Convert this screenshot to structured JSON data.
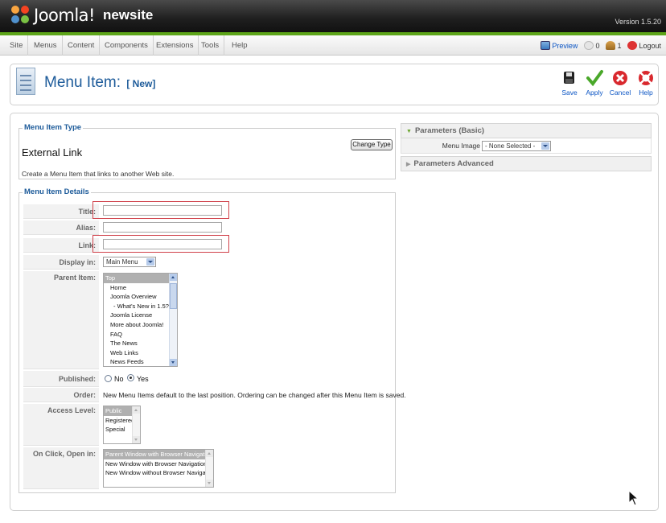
{
  "header": {
    "logo_text": "Joomla!",
    "site_name": "newsite",
    "version": "Version 1.5.20"
  },
  "menubar": {
    "items": [
      "Site",
      "Menus",
      "Content",
      "Components",
      "Extensions",
      "Tools",
      "Help"
    ],
    "preview": "Preview",
    "messages_count": "0",
    "users_count": "1",
    "logout": "Logout"
  },
  "toolbar": {
    "title": "Menu Item:",
    "subtitle": "[ New]",
    "save": "Save",
    "apply": "Apply",
    "cancel": "Cancel",
    "help": "Help"
  },
  "menu_item_type": {
    "legend": "Menu Item Type",
    "type_name": "External Link",
    "description": "Create a Menu Item that links to another Web site.",
    "change_button": "Change Type"
  },
  "details": {
    "legend": "Menu Item Details",
    "title_label": "Title:",
    "title_value": "",
    "alias_label": "Alias:",
    "alias_value": "",
    "link_label": "Link:",
    "link_value": "",
    "display_in_label": "Display in:",
    "display_in_value": "Main Menu",
    "parent_label": "Parent Item:",
    "parent_options": [
      "Top",
      "Home",
      "Joomla Overview",
      "- What's New in 1.5?",
      "Joomla License",
      "More about Joomla!",
      "FAQ",
      "The News",
      "Web Links",
      "News Feeds"
    ],
    "parent_selected": "Top",
    "published_label": "Published:",
    "published_no": "No",
    "published_yes": "Yes",
    "published_value": "Yes",
    "order_label": "Order:",
    "order_text": "New Menu Items default to the last position. Ordering can be changed after this Menu Item is saved.",
    "access_label": "Access Level:",
    "access_options": [
      "Public",
      "Registered",
      "Special"
    ],
    "access_selected": "Public",
    "onclick_label": "On Click, Open in:",
    "onclick_options": [
      "Parent Window with Browser Navigation",
      "New Window with Browser Navigation",
      "New Window without Browser Navigation"
    ],
    "onclick_selected": "Parent Window with Browser Navigation"
  },
  "parameters": {
    "basic_label": "Parameters (Basic)",
    "menu_image_label": "Menu Image",
    "menu_image_value": "- None Selected -",
    "advanced_label": "Parameters Advanced"
  }
}
